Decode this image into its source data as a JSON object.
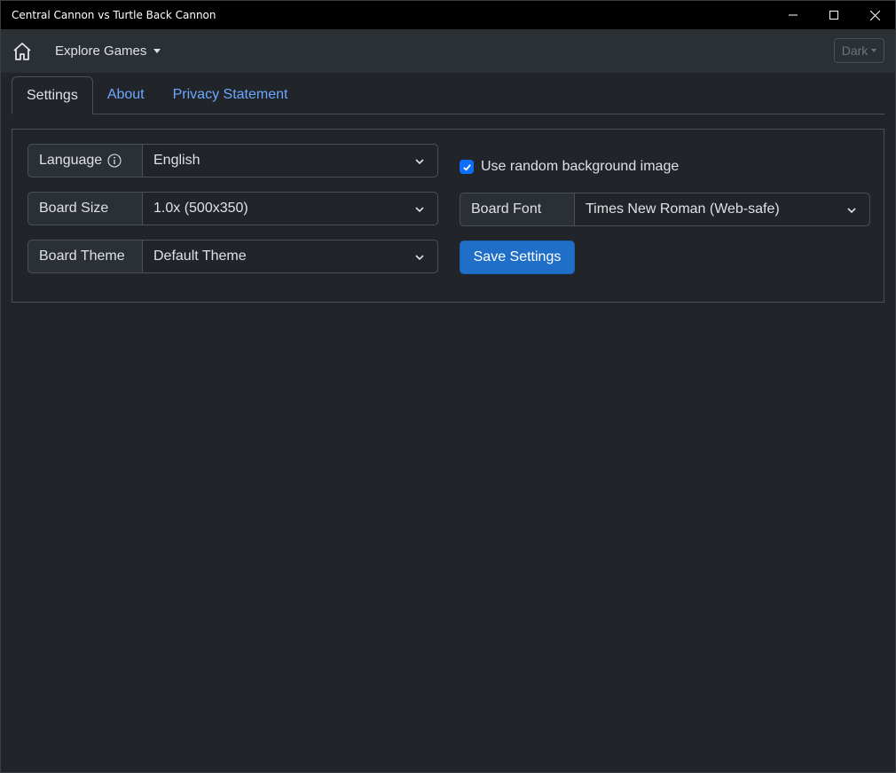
{
  "window": {
    "title": "Central Cannon vs Turtle Back Cannon"
  },
  "navbar": {
    "home_icon": "home-icon",
    "explore_label": "Explore Games",
    "theme_label": "Dark"
  },
  "tabs": [
    {
      "label": "Settings",
      "active": true
    },
    {
      "label": "About",
      "active": false
    },
    {
      "label": "Privacy Statement",
      "active": false
    }
  ],
  "settings": {
    "language": {
      "label": "Language",
      "value": "English",
      "icon": "info-icon"
    },
    "board_size": {
      "label": "Board Size",
      "value": "1.0x (500x350)"
    },
    "board_theme": {
      "label": "Board Theme",
      "value": "Default Theme"
    },
    "random_bg": {
      "label": "Use random background image",
      "checked": true
    },
    "board_font": {
      "label": "Board Font",
      "value": "Times New Roman (Web-safe)"
    },
    "save_label": "Save Settings"
  },
  "colors": {
    "background": "#212529",
    "navbar": "#2b3035",
    "accent": "#0d6efd",
    "link": "#6ea8fe"
  }
}
